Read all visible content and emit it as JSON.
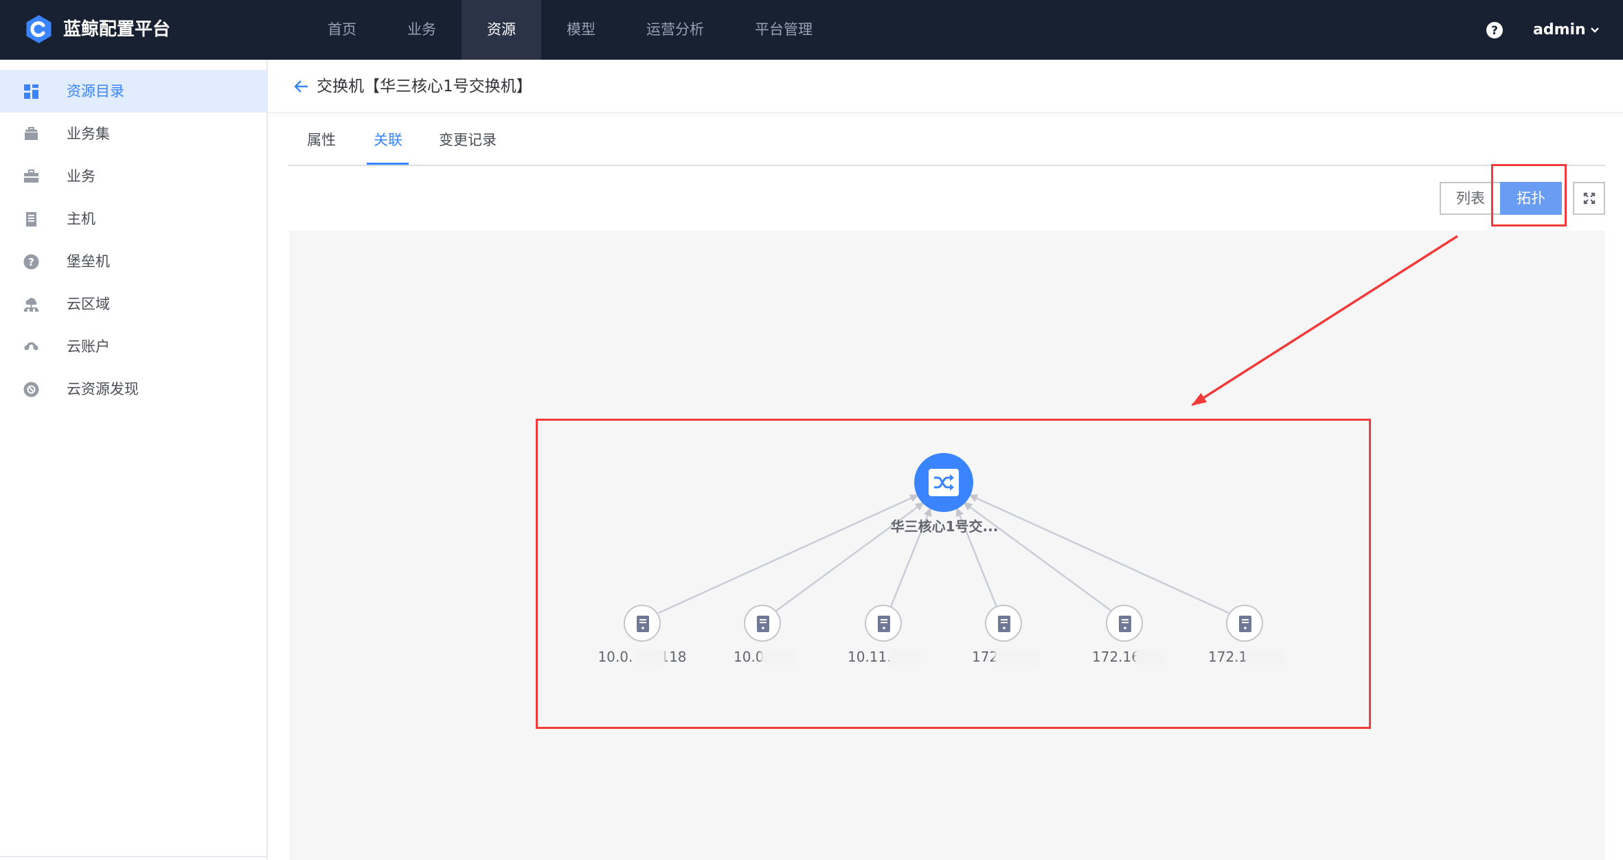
{
  "header": {
    "brand": "蓝鲸配置平台",
    "nav": [
      "首页",
      "业务",
      "资源",
      "模型",
      "运营分析",
      "平台管理"
    ],
    "active_nav": "资源",
    "user": "admin"
  },
  "sidebar": {
    "items": [
      {
        "label": "资源目录",
        "icon": "grid-icon",
        "active": true
      },
      {
        "label": "业务集",
        "icon": "briefcase-stack-icon"
      },
      {
        "label": "业务",
        "icon": "briefcase-icon"
      },
      {
        "label": "主机",
        "icon": "server-icon"
      },
      {
        "label": "堡垒机",
        "icon": "question-circle-icon"
      },
      {
        "label": "云区域",
        "icon": "cloud-network-icon"
      },
      {
        "label": "云账户",
        "icon": "cloud-account-icon"
      },
      {
        "label": "云资源发现",
        "icon": "cloud-discover-icon"
      }
    ]
  },
  "page": {
    "title": "交换机【华三核心1号交换机】",
    "tabs": [
      "属性",
      "关联",
      "变更记录"
    ],
    "active_tab": "关联",
    "view_switch": {
      "list": "列表",
      "topo": "拓扑",
      "active": "拓扑"
    }
  },
  "topology": {
    "center": {
      "label": "华三核心1号交...",
      "icon": "switch-shuffle-icon",
      "color": "#3a84ff"
    },
    "leaves": [
      {
        "label": "10.0.",
        "label_end": "118",
        "icon": "host-icon"
      },
      {
        "label": "10.0.",
        "label_end": "",
        "icon": "host-icon"
      },
      {
        "label": "10.11.2",
        "label_end": "",
        "icon": "host-icon"
      },
      {
        "label": "172",
        "label_end": "",
        "icon": "host-icon"
      },
      {
        "label": "172.16",
        "label_end": "",
        "icon": "host-icon"
      },
      {
        "label": "172.1",
        "label_end": "",
        "icon": "host-icon"
      }
    ]
  },
  "colors": {
    "topbar": "#182132",
    "accent": "#3a84ff",
    "annotation": "#f23a3a"
  }
}
